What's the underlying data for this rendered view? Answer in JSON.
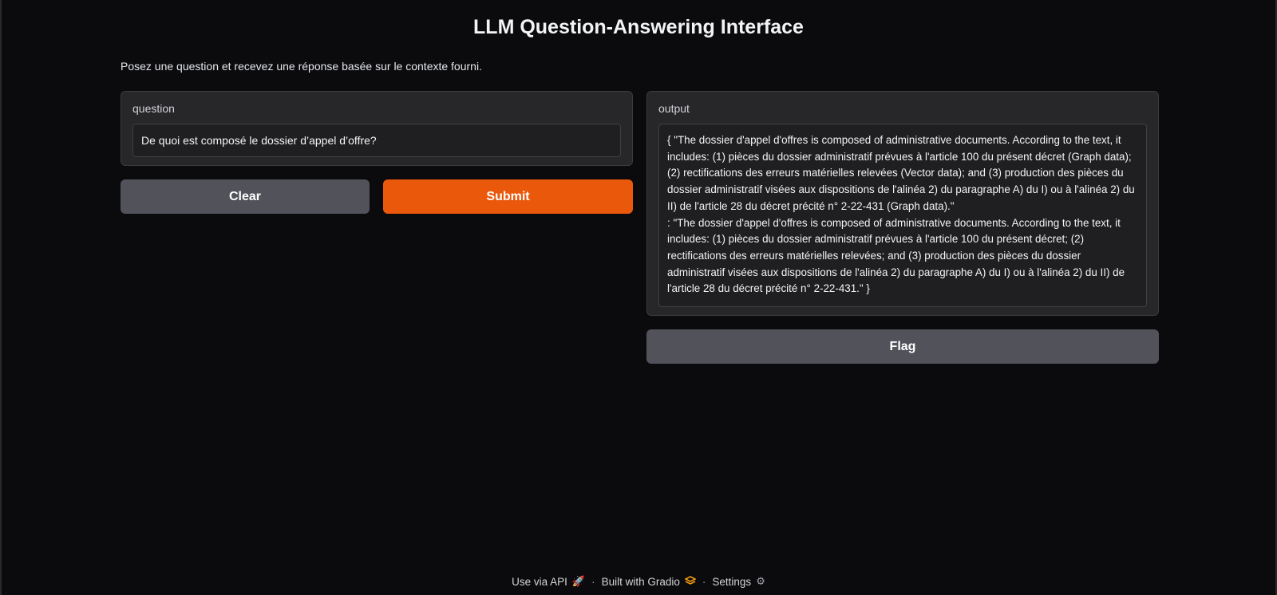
{
  "header": {
    "title": "LLM Question-Answering Interface",
    "description": "Posez une question et recevez une réponse basée sur le contexte fourni."
  },
  "question": {
    "label": "question",
    "value": "De quoi est composé le dossier d’appel d’offre?"
  },
  "buttons": {
    "clear": "Clear",
    "submit": "Submit",
    "flag": "Flag"
  },
  "output": {
    "label": "output",
    "value": "{ \"The dossier d'appel d'offres is composed of administrative documents. According to the text, it includes: (1) pièces du dossier administratif prévues à l'article 100 du présent décret (Graph data); (2) rectifications des erreurs matérielles relevées (Vector data); and (3) production des pièces du dossier administratif visées aux dispositions de l'alinéa 2) du paragraphe A) du I) ou à l'alinéa 2) du II) de l'article 28 du décret précité n° 2-22-431 (Graph data).\"\n: \"The dossier d'appel d'offres is composed of administrative documents. According to the text, it includes: (1) pièces du dossier administratif prévues à l'article 100 du présent décret; (2) rectifications des erreurs matérielles relevées; and (3) production des pièces du dossier administratif visées aux dispositions de l'alinéa 2) du paragraphe A) du I) ou à l'alinéa 2) du II) de l'article 28 du décret précité n° 2-22-431.\" }"
  },
  "footer": {
    "api": "Use via API",
    "built": "Built with Gradio",
    "settings": "Settings",
    "separator": "·",
    "icons": [
      "rocket-icon",
      "gradio-logo-icon",
      "gear-icon"
    ],
    "accent": "#ea580c"
  }
}
